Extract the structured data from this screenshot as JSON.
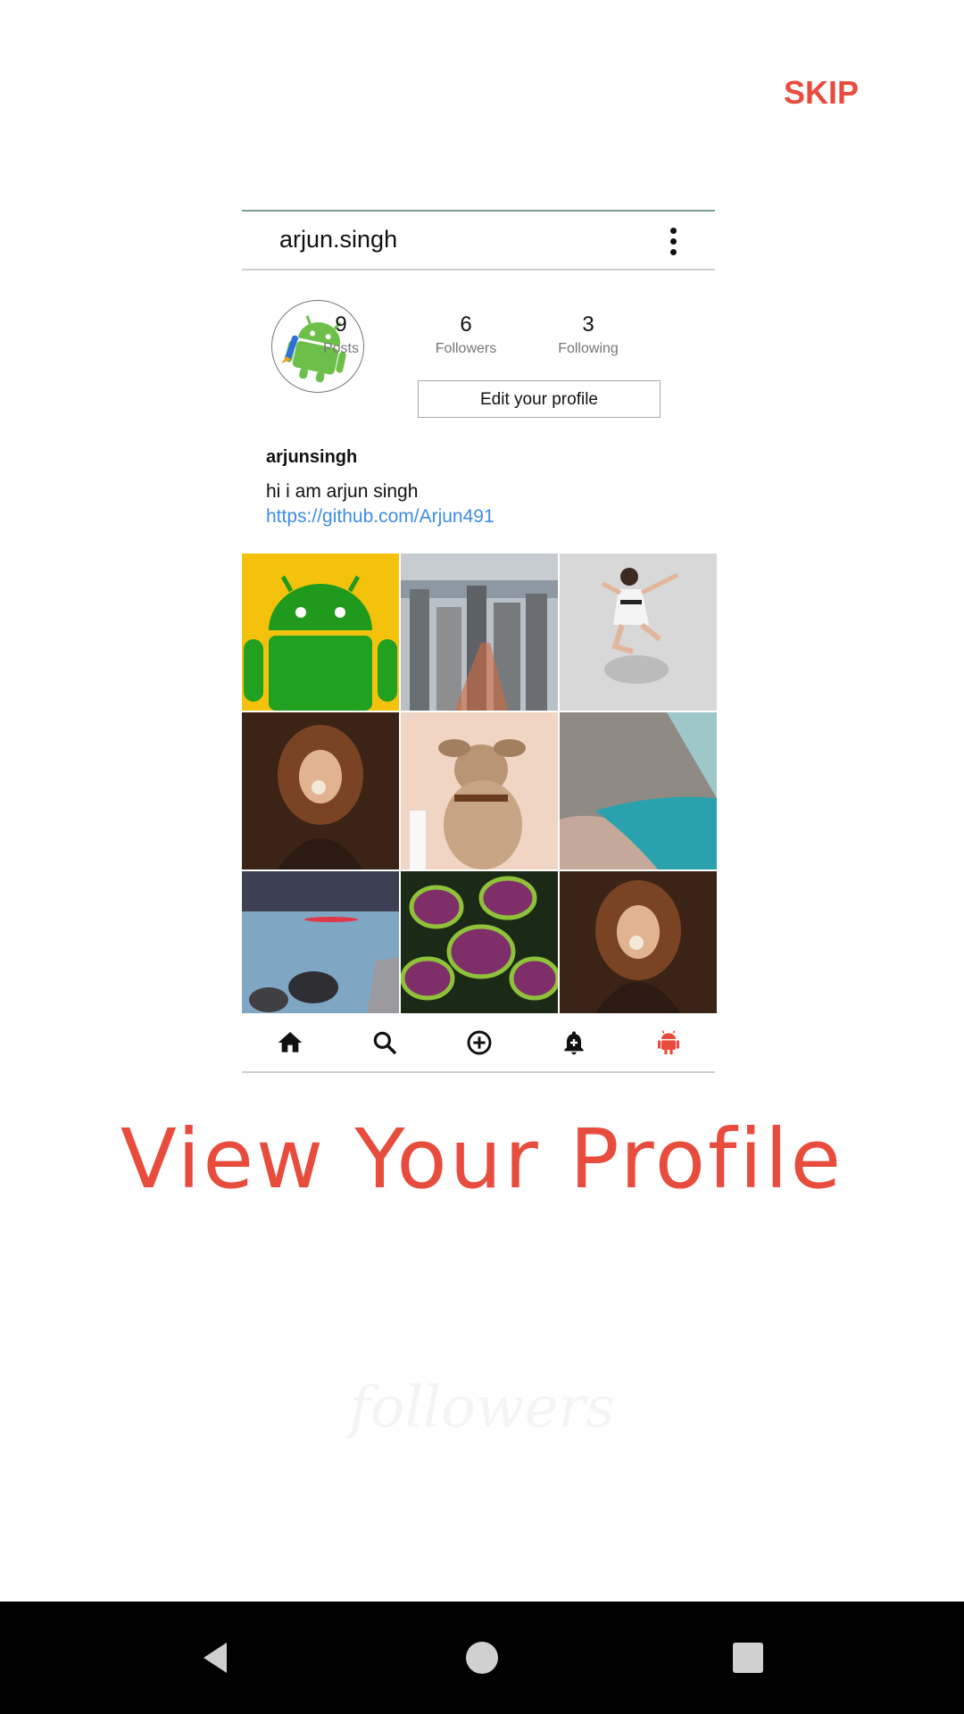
{
  "skip_label": "SKIP",
  "profile": {
    "username": "arjun.singh",
    "stats": [
      {
        "value": "9",
        "label": "Posts"
      },
      {
        "value": "6",
        "label": "Followers"
      },
      {
        "value": "3",
        "label": "Following"
      }
    ],
    "edit_label": "Edit your profile",
    "bio_name": "arjunsingh",
    "bio_text": "hi i am arjun singh",
    "bio_link": "https://github.com/Arjun491"
  },
  "grid_images": [
    "android-robot-photo",
    "city-skyline-photo",
    "dancer-jumping-photo",
    "woman-dandelion-photo",
    "dog-photo",
    "beach-cliff-photo",
    "sunset-sea-rocks-photo",
    "coleus-leaves-photo",
    "woman-dandelion-photo"
  ],
  "bottom_nav": [
    "home-icon",
    "search-icon",
    "add-circle-icon",
    "notification-add-icon",
    "android-profile-icon"
  ],
  "headline": "View Your Profile",
  "ghost_text": "followers",
  "colors": {
    "accent": "#e84c3d",
    "link": "#3e8de4",
    "system_bar": "#000000"
  }
}
